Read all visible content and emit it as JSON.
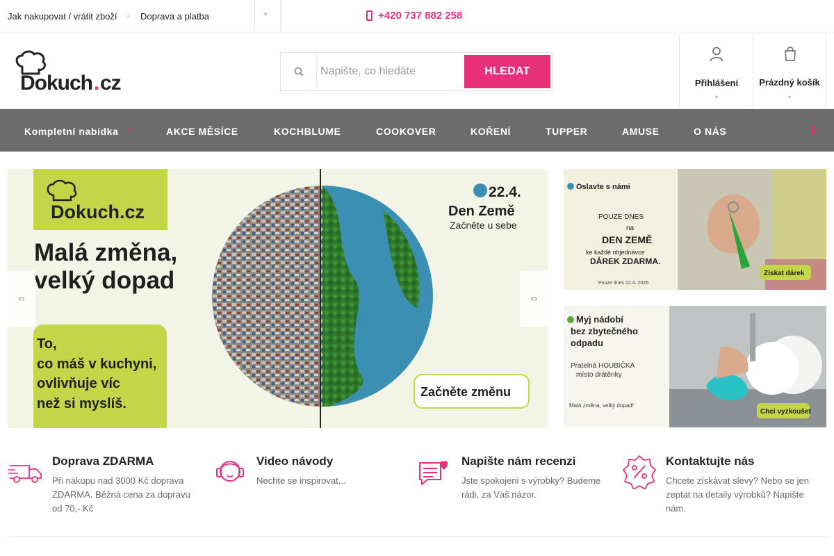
{
  "topbar": {
    "links": [
      "Jak nakupovat / vrátit zboží",
      "Doprava a platba"
    ],
    "phone": "+420 737 882 258"
  },
  "brand": {
    "name": "Dokuch.cz"
  },
  "search": {
    "placeholder": "Napište, co hledáte",
    "button_label": "HLEDAT"
  },
  "header": {
    "login_label": "Přihlášení",
    "cart_label": "Prázdný košík"
  },
  "nav": {
    "items": [
      "Kompletní nabídka",
      "AKCE MĚSÍCE",
      "KOCHBLUME",
      "COOKOVER",
      "KOŘENÍ",
      "TUPPER",
      "AMUSE",
      "O NÁS"
    ]
  },
  "hero": {
    "logo": "Dokuch.cz",
    "headline_1": "Malá změna,",
    "headline_2": "velký dopad",
    "date": "22.4.",
    "event": "Den Země",
    "event_sub": "Začněte u sebe",
    "body_lines": [
      "To,",
      "co máš v kuchyni,",
      "ovlivňuje víc",
      "než si myslíš."
    ],
    "cta": "Začněte změnu"
  },
  "side_banner_1": {
    "top": "Oslavte s námi",
    "line1": "POUZE DNES",
    "line2": "na",
    "line3": "DEN ZEMĚ",
    "line4": "ke každé objednávce",
    "line5": "DÁREK ZDARMA.",
    "note": "Pouze dnes 22.4. 2026",
    "cta": "Získat dárek"
  },
  "side_banner_2": {
    "title_1": "Myj nádobí",
    "title_2": "bez zbytečného",
    "title_3": "odpadu",
    "sub_1": "Pratelná HOUBIČKA",
    "sub_2": "místo drátěnky",
    "tagline": "Malá změna, velký dopad!",
    "cta": "Chci vyzkoušet"
  },
  "features": [
    {
      "title": "Doprava ZDARMA",
      "lines": [
        "Při nákupu nad 3000 Kč doprava",
        "ZDARMA. Běžná cena za dopravu",
        "od 70,- Kč"
      ]
    },
    {
      "title": "Video návody",
      "lines": [
        "Nechte se inspirovat..."
      ]
    },
    {
      "title": "Napište nám recenzi",
      "lines": [
        "Jste spokojeni s výrobky? Budeme",
        "rádi, za Váš názor."
      ]
    },
    {
      "title": "Kontaktujte nás",
      "lines": [
        "Chcete získávat slevy? Nebo se jen",
        "zeptat na detaily výrobků? Napište",
        "nám."
      ]
    }
  ],
  "colors": {
    "accent": "#e8307a",
    "nav_bg": "#6c6c6c",
    "lime": "#c3d647",
    "dark_green": "#1e4d1e"
  },
  "icons": [
    "phone-icon",
    "search-icon",
    "user-icon",
    "cart-icon",
    "chevron-down-icon",
    "chevron-left-icon",
    "chevron-right-icon",
    "truck-icon",
    "headset-icon",
    "chat-heart-icon",
    "percent-badge-icon"
  ]
}
